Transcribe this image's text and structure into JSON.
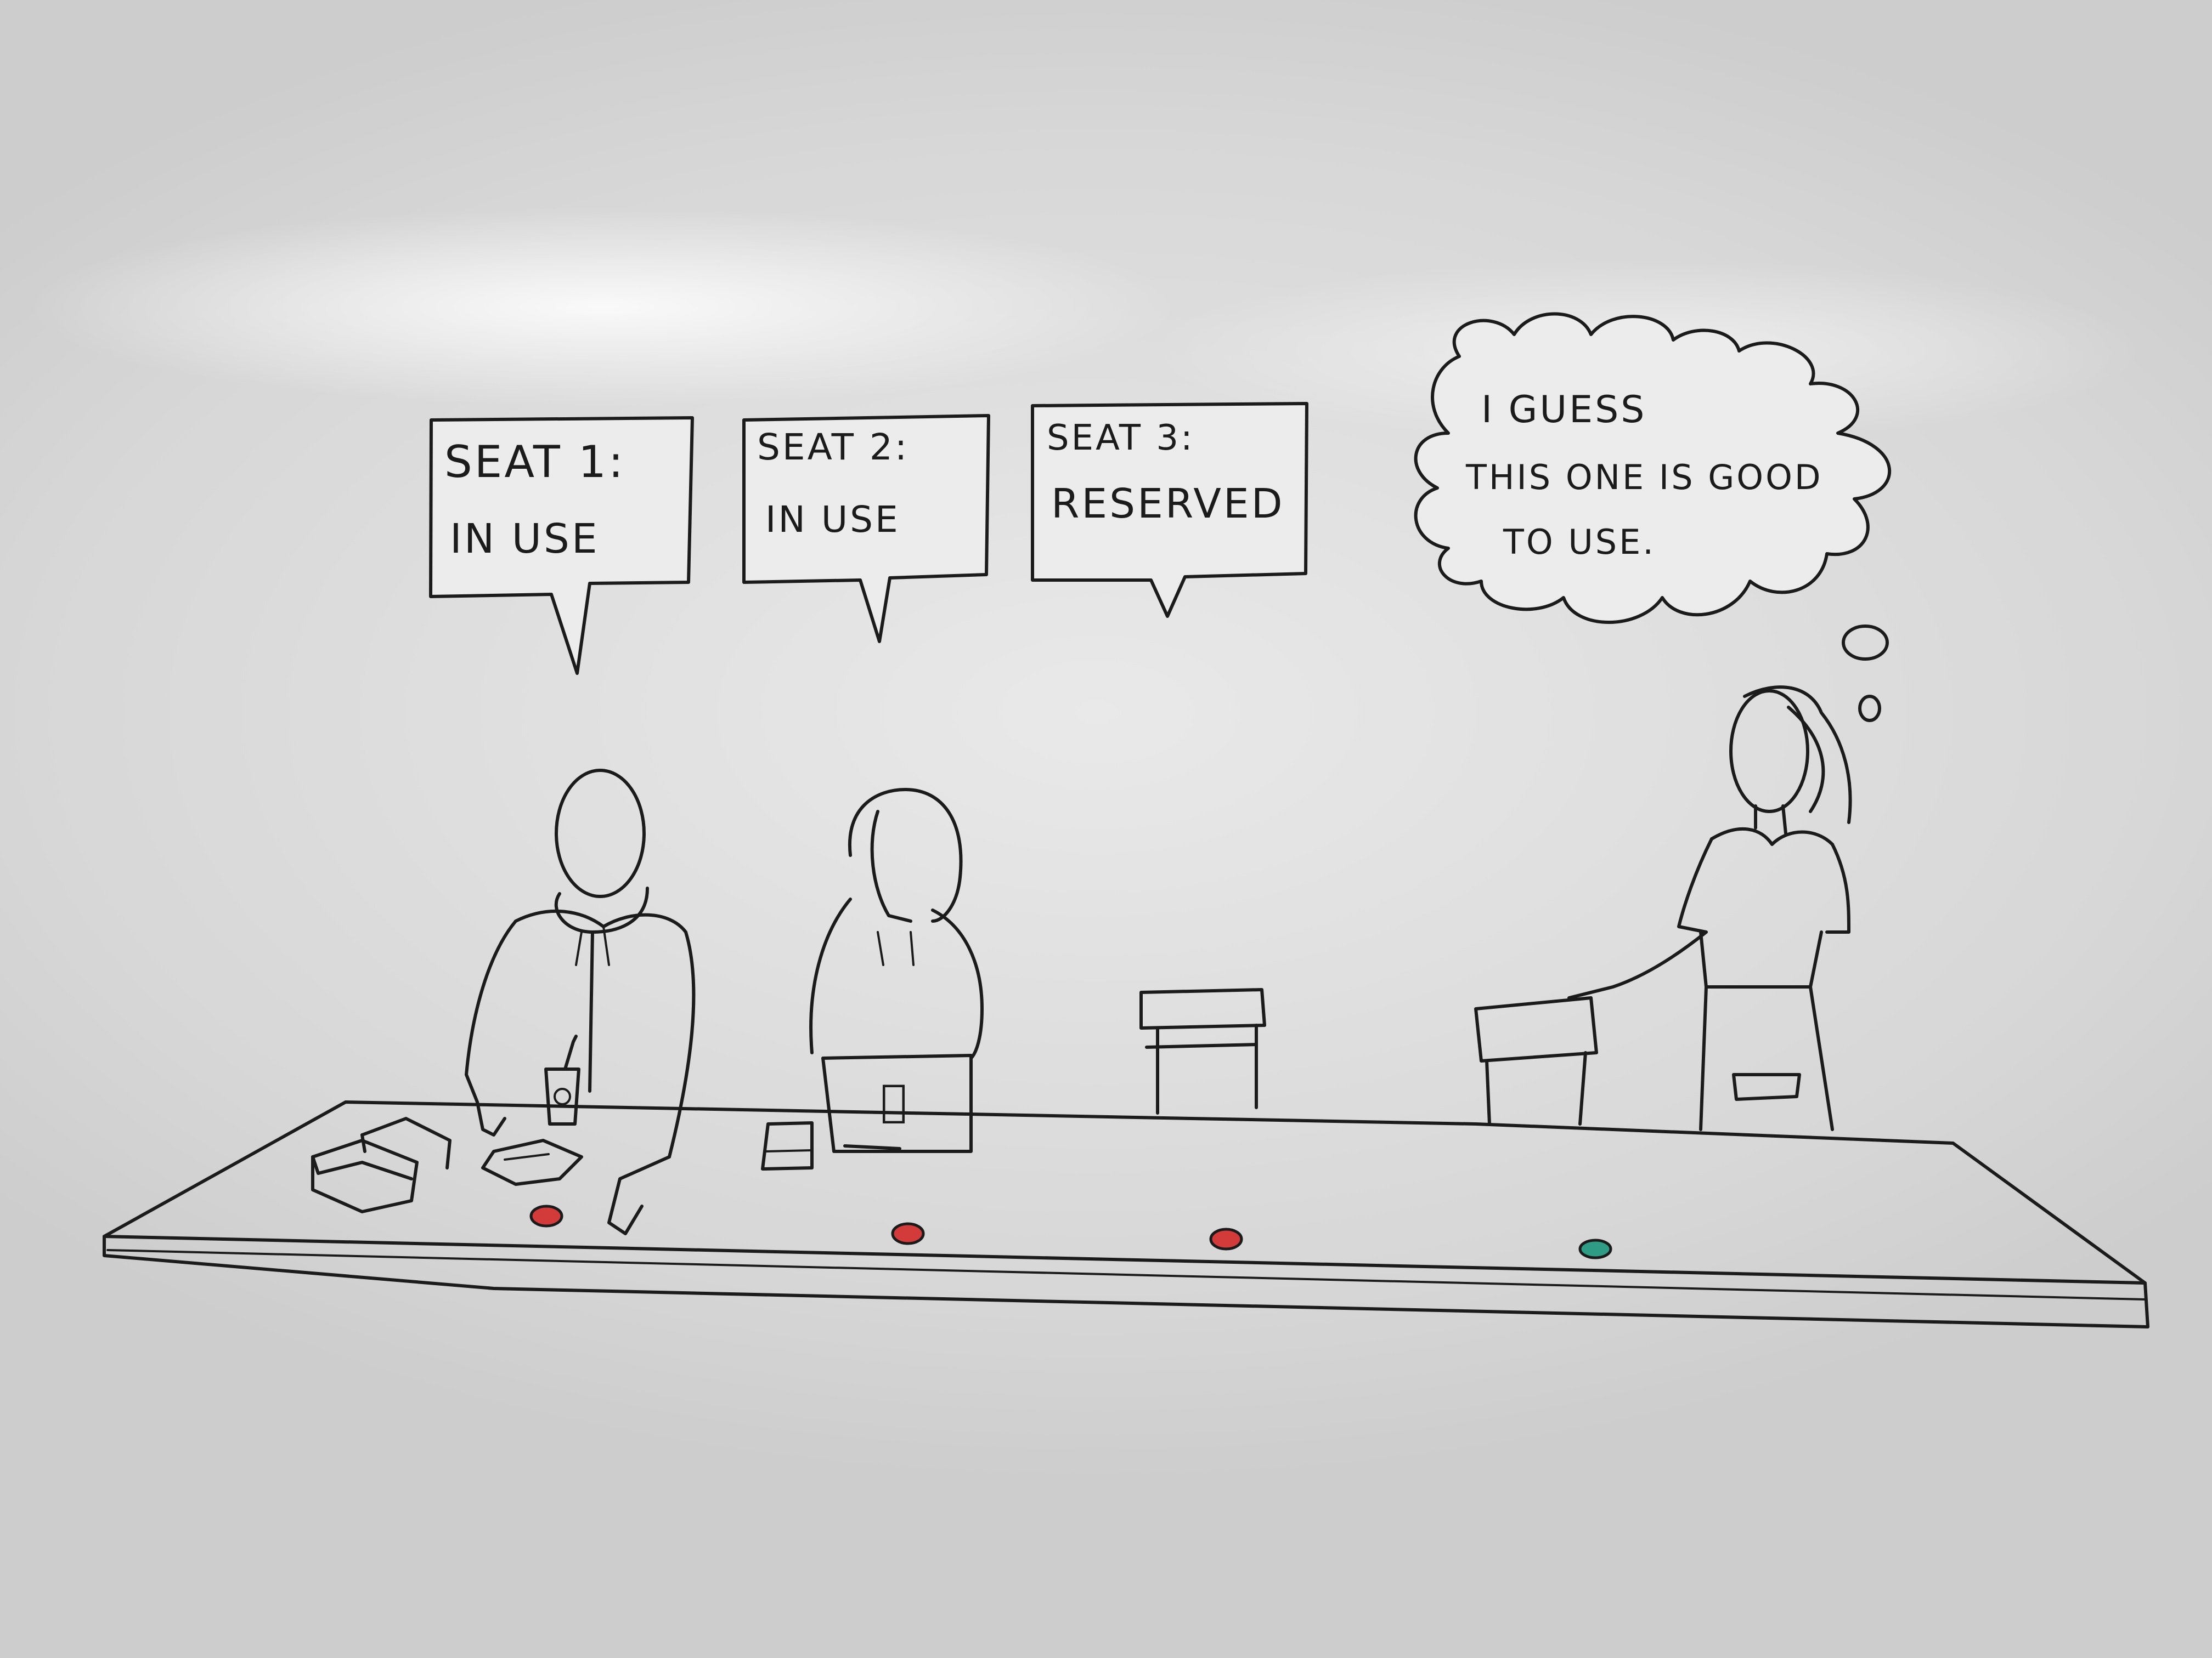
{
  "bubbles": {
    "seat1": {
      "label": "SEAT 1:",
      "status": "IN USE"
    },
    "seat2": {
      "label": "SEAT 2:",
      "status": "IN USE"
    },
    "seat3": {
      "label": "SEAT 3:",
      "status": "RESERVED"
    }
  },
  "thought": {
    "line1": "I GUESS",
    "line2": "THIS ONE IS GOOD",
    "line3": "TO USE."
  },
  "indicators": [
    {
      "seat": "1",
      "color": "#d33b3b"
    },
    {
      "seat": "2",
      "color": "#d33b3b"
    },
    {
      "seat": "3",
      "color": "#d33b3b"
    },
    {
      "seat": "4",
      "color": "#2f9c86"
    }
  ],
  "colors": {
    "ink": "#1b1b1b",
    "board": "#e4e4e4"
  }
}
